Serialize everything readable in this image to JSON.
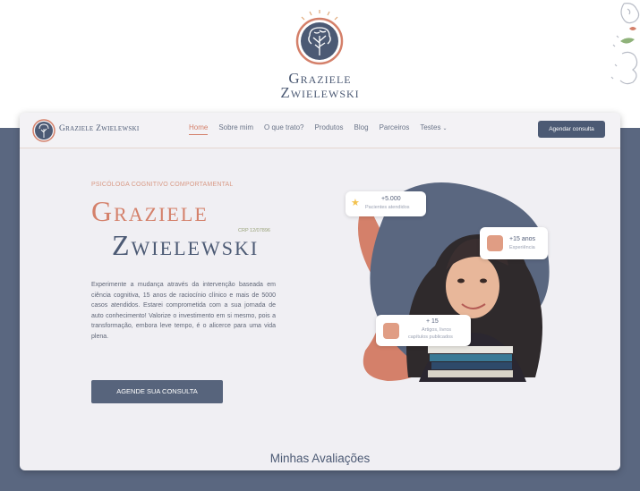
{
  "brand": {
    "line1": "Graziele",
    "line2": "Zwielewski",
    "nav_name": "Graziele Zwielewski"
  },
  "nav": {
    "links": [
      "Home",
      "Sobre mim",
      "O que trato?",
      "Produtos",
      "Blog",
      "Parceiros",
      "Testes"
    ],
    "active": "Home",
    "cta": "Agendar consulta"
  },
  "hero": {
    "eyebrow": "PSICÓLOGA COGNITIVO COMPORTAMENTAL",
    "first_name": "Graziele",
    "last_name": "Zwielewski",
    "crp": "CRP 12/07896",
    "description": "Experimente a mudança através da intervenção baseada em ciência cognitiva, 15 anos de raciocínio clínico e mais de 5000 casos atendidos. Estarei comprometida com a sua jornada de auto conhecimento! Valorize o investimento em si mesmo, pois a transformação, embora leve tempo, é o alicerce para uma vida plena.",
    "button": "AGENDE SUA CONSULTA"
  },
  "badges": {
    "patients": {
      "title": "+5.000",
      "sub": "Pacientes atendidos"
    },
    "experience": {
      "title": "+15 anos",
      "sub": "Experiência"
    },
    "articles": {
      "title": "+ 15",
      "sub_1": "Artigos, livros",
      "sub_2": "capítulos publicados"
    }
  },
  "reviews": {
    "title": "Minhas Avaliações"
  },
  "colors": {
    "navy": "#4c5a74",
    "accent": "#d4806a",
    "backdrop": "#5a6780"
  }
}
